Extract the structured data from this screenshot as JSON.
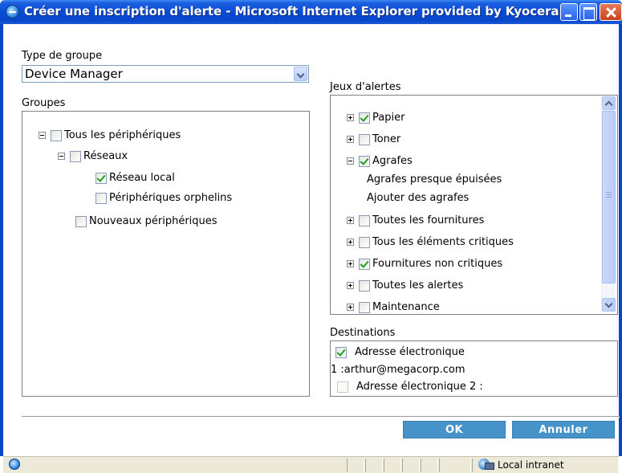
{
  "window": {
    "title": "Créer une inscription d'alerte - Microsoft Internet Explorer provided by Kyocera..."
  },
  "group_type": {
    "label": "Type de groupe",
    "selected": "Device Manager"
  },
  "groups": {
    "label": "Groupes",
    "items": [
      {
        "label": "Tous les périphériques",
        "checked": false
      },
      {
        "label": "Réseaux",
        "checked": false
      },
      {
        "label": "Réseau local",
        "checked": true
      },
      {
        "label": "Périphériques orphelins",
        "checked": false
      },
      {
        "label": "Nouveaux périphériques",
        "checked": false
      }
    ]
  },
  "alert_sets": {
    "label": "Jeux d'alertes",
    "items": [
      {
        "label": "Papier",
        "checked": true
      },
      {
        "label": "Toner",
        "checked": false
      },
      {
        "label": "Agrafes",
        "checked": true
      },
      {
        "label": "Agrafes presque épuisées"
      },
      {
        "label": "Ajouter des agrafes"
      },
      {
        "label": "Toutes les fournitures",
        "checked": false
      },
      {
        "label": "Tous les éléments critiques",
        "checked": false
      },
      {
        "label": "Fournitures non critiques",
        "checked": true
      },
      {
        "label": "Toutes les alertes",
        "checked": false
      },
      {
        "label": "Maintenance",
        "checked": false
      }
    ]
  },
  "destinations": {
    "label": "Destinations",
    "email1_label": "Adresse électronique",
    "email1_value": "1 :arthur@megacorp.com",
    "email1_checked": true,
    "email2_label": "Adresse électronique 2 :",
    "email2_checked": false
  },
  "buttons": {
    "ok": "OK",
    "cancel": "Annuler"
  },
  "statusbar": {
    "zone": "Local intranet"
  }
}
